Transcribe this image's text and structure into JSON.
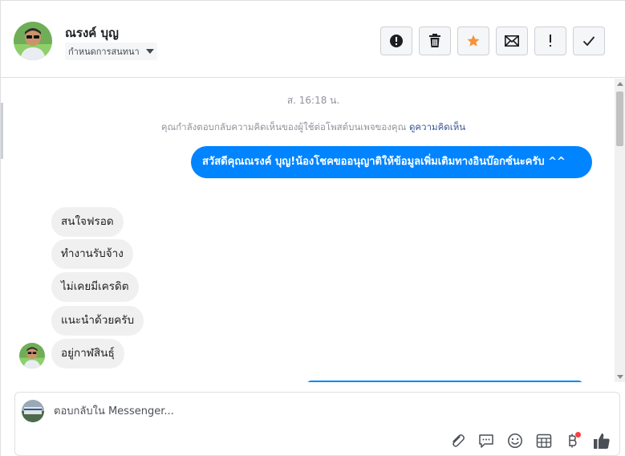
{
  "header": {
    "contact_name": "ณรงค์ บุญ",
    "assign_label": "กำหนดการสนทนา",
    "actions": [
      {
        "name": "spam-button",
        "icon": "alert-circle-icon"
      },
      {
        "name": "delete-button",
        "icon": "trash-icon"
      },
      {
        "name": "star-button",
        "icon": "star-icon"
      },
      {
        "name": "mark-unread-button",
        "icon": "envelope-icon"
      },
      {
        "name": "follow-up-button",
        "icon": "exclamation-icon"
      },
      {
        "name": "mark-done-button",
        "icon": "check-icon"
      }
    ]
  },
  "conversation": {
    "timestamp": "ส. 16:18 น.",
    "context_text": "คุณกำลังตอบกลับความคิดเห็นของผู้ใช้ต่อโพสต์บนเพจของคุณ",
    "context_link": "ดูความคิดเห็น",
    "outgoing": "สวัสดีคุณณรงค์ บุญ!น้องโชคขออนุญาติให้ข้อมูลเพิ่มเติมทางอินบ๊อกซ์นะครับ ^^",
    "incoming": [
      "สนใจฟรอด",
      "ทำงานรับจ้าง",
      "ไม่เคยมีเครดิต",
      "แนะนำด้วยครับ",
      "อยู่กาฬสินธุ์"
    ]
  },
  "composer": {
    "placeholder": "ตอบกลับใน Messenger...",
    "tools": [
      "attachment-icon",
      "saved-reply-icon",
      "emoji-icon",
      "appointment-icon",
      "payment-icon",
      "like-icon"
    ]
  },
  "colors": {
    "accent": "#0084ff",
    "star": "#f7923b",
    "incoming_bg": "#f1f0f0",
    "link": "#385898"
  }
}
